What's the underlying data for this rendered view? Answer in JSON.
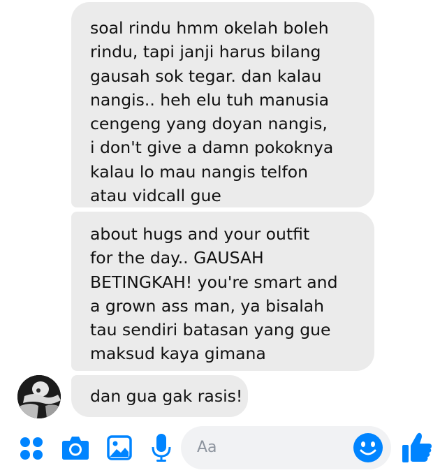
{
  "conversation": {
    "messages": [
      {
        "lines": [
          "soal rindu hmm okelah boleh",
          "rindu, tapi janji harus bilang",
          "gausah sok tegar. dan kalau",
          "nangis.. heh elu tuh manusia",
          "cengeng yang doyan nangis,",
          "i don't give a damn pokoknya",
          "kalau lo mau nangis telfon",
          "atau vidcall gue"
        ]
      },
      {
        "lines": [
          "about hugs and your outfit",
          "for the day.. GAUSAH",
          "BETINGKAH! you're smart and",
          "a grown ass man, ya bisalah",
          "tau sendiri batasan yang gue",
          "maksud kaya gimana"
        ]
      },
      {
        "lines": [
          "dan gua gak rasis!"
        ]
      }
    ]
  },
  "composer": {
    "placeholder": "Aa",
    "icons": [
      "apps-icon",
      "camera-icon",
      "gallery-icon",
      "microphone-icon",
      "emoji-icon",
      "like-icon"
    ],
    "accent_color": "#0084ff"
  }
}
